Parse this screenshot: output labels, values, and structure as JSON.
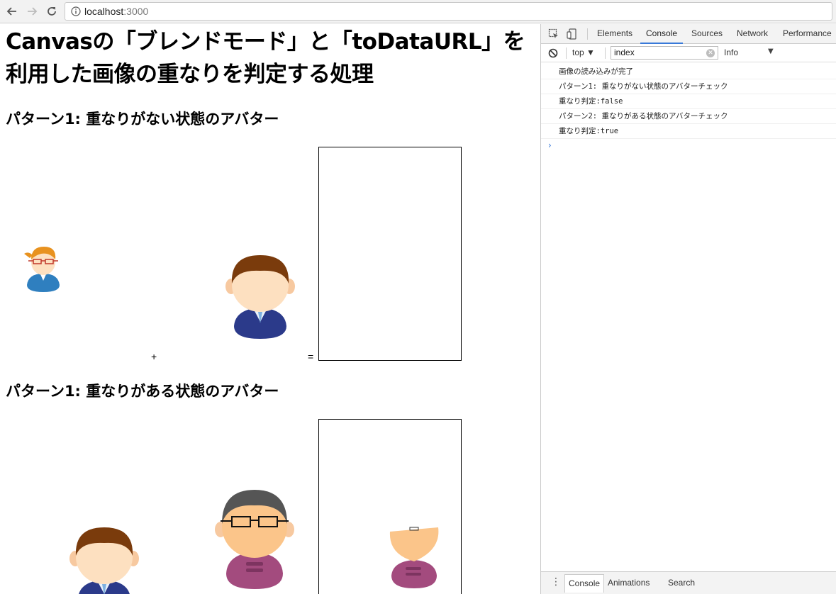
{
  "browser": {
    "url_host": "localhost",
    "url_port": ":3000"
  },
  "page": {
    "title": "Canvasの「ブレンドモード」と「toDataURL」を利用した画像の重なりを判定する処理",
    "sections": [
      {
        "heading": "パターン1: 重なりがない状態のアバター",
        "plus": "+",
        "equals": "="
      },
      {
        "heading": "パターン1: 重なりがある状態のアバター"
      }
    ]
  },
  "devtools": {
    "tabs": [
      "Elements",
      "Console",
      "Sources",
      "Network",
      "Performance"
    ],
    "active_tab": "Console",
    "context": "top",
    "filter_value": "index",
    "level": "Info",
    "console_messages": [
      "画像の読み込みが完了",
      "パターン1: 重なりがない状態のアバターチェック",
      "重なり判定:false",
      "パターン2: 重なりがある状態のアバターチェック",
      "重なり判定:true"
    ],
    "drawer_tabs": [
      "Console",
      "Animations",
      "Search"
    ],
    "drawer_active": "Console"
  },
  "colors": {
    "accent": "#3879d9",
    "hair_brown": "#7a3b0c",
    "hair_orange": "#e8921f",
    "suit_navy": "#2b3a8a",
    "shirt_blue": "#3a7fc0",
    "sweater_pink": "#a34b7e",
    "skin": "#fde0c0"
  }
}
